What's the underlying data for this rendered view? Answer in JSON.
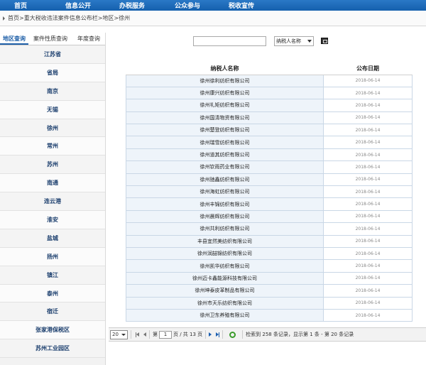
{
  "nav": {
    "items": [
      "首页",
      "信息公开",
      "办税服务",
      "公众参与",
      "税收宣传"
    ]
  },
  "breadcrumb": {
    "items": [
      "首页",
      "重大税收违法案件信息公布栏",
      "地区",
      "徐州"
    ]
  },
  "sidebar": {
    "tabs": [
      "地区查询",
      "案件性质查询",
      "年度查询"
    ],
    "items": [
      "江苏省",
      "省局",
      "南京",
      "无锡",
      "徐州",
      "常州",
      "苏州",
      "南通",
      "连云港",
      "淮安",
      "盐城",
      "扬州",
      "镇江",
      "泰州",
      "宿迁",
      "张家港保税区",
      "苏州工业园区"
    ]
  },
  "search": {
    "input_value": "",
    "select_value": "纳税人名称"
  },
  "table": {
    "headers": [
      "纳税人名称",
      "公布日期"
    ],
    "rows": [
      {
        "name": "徐州徐利纺织有限公司",
        "date": "2018-06-14"
      },
      {
        "name": "徐州康兴纺织有限公司",
        "date": "2018-06-14"
      },
      {
        "name": "徐州礼矩纺织有限公司",
        "date": "2018-06-14"
      },
      {
        "name": "徐州国清物资有限公司",
        "date": "2018-06-14"
      },
      {
        "name": "徐州楚登纺织有限公司",
        "date": "2018-06-14"
      },
      {
        "name": "徐州瑞雪纺织有限公司",
        "date": "2018-06-14"
      },
      {
        "name": "徐州道其纺织有限公司",
        "date": "2018-06-14"
      },
      {
        "name": "徐州钦雨药业有限公司",
        "date": "2018-06-14"
      },
      {
        "name": "徐州驰鑫纺织有限公司",
        "date": "2018-06-14"
      },
      {
        "name": "徐州海虹纺织有限公司",
        "date": "2018-06-14"
      },
      {
        "name": "徐州丰锦纺织有限公司",
        "date": "2018-06-14"
      },
      {
        "name": "徐州晨辉纺织有限公司",
        "date": "2018-06-14"
      },
      {
        "name": "徐州共利纺织有限公司",
        "date": "2018-06-14"
      },
      {
        "name": "丰县宜然美纺织有限公司",
        "date": "2018-06-14"
      },
      {
        "name": "徐州润喆锦纺织有限公司",
        "date": "2018-06-14"
      },
      {
        "name": "徐州凯华纺织有限公司",
        "date": "2018-06-14"
      },
      {
        "name": "徐州迈卡鑫能源科技有限公司",
        "date": "2018-06-14"
      },
      {
        "name": "徐州坤泰皮革制品有限公司",
        "date": "2018-06-14"
      },
      {
        "name": "徐州市天乐纺织有限公司",
        "date": "2018-06-14"
      },
      {
        "name": "徐州卫东养殖有限公司",
        "date": "2018-06-14"
      }
    ]
  },
  "pager": {
    "page_size": "20",
    "page_prefix": "第",
    "page_value": "1",
    "page_suffix": "页 / 共 13 页",
    "summary": "检索到 258 条记录，显示第 1 条 - 第 20 条记录"
  },
  "colors": {
    "nav_bg": "#1e6bb8",
    "sidebar_link": "#1c3f6e",
    "row_bg": "#eef4fa",
    "refresh": "#3a9b2a"
  }
}
